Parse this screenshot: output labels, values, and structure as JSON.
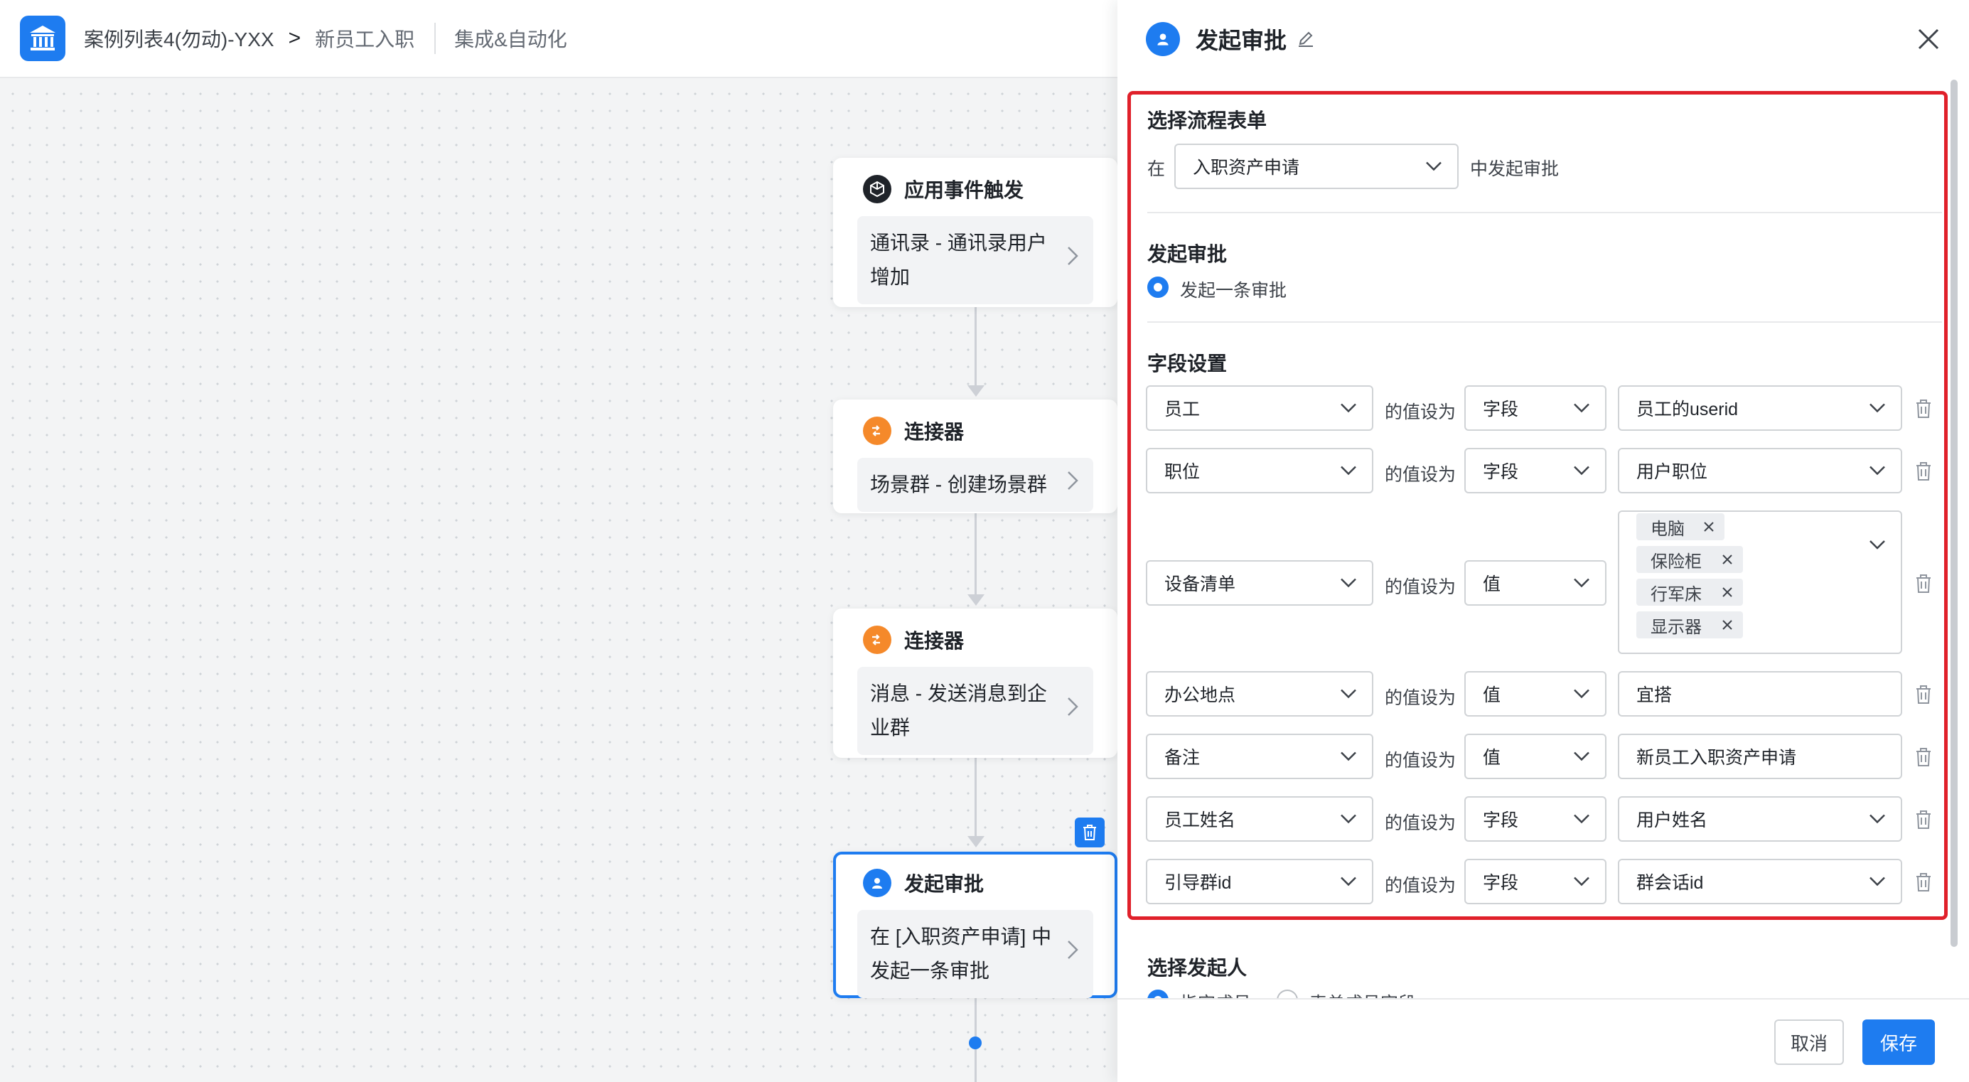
{
  "breadcrumb": {
    "app_name": "案例列表4(勿动)-YXX",
    "separator": ">",
    "page": "新员工入职",
    "section": "集成&自动化"
  },
  "flow": {
    "nodes": [
      {
        "title": "应用事件触发",
        "body": "通讯录 - 通讯录用户增加",
        "icon": "cube-icon",
        "icon_color": "#1f2329"
      },
      {
        "title": "连接器",
        "body": "场景群 - 创建场景群",
        "icon": "connector-icon",
        "icon_color": "#f5892a"
      },
      {
        "title": "连接器",
        "body": "消息 - 发送消息到企业群",
        "icon": "connector-icon",
        "icon_color": "#f5892a"
      },
      {
        "title": "发起审批",
        "body": "在 [入职资产申请] 中发起一条审批",
        "icon": "user-icon",
        "icon_color": "#1e7cf0"
      }
    ]
  },
  "drawer": {
    "title": "发起审批",
    "section_form": {
      "title": "选择流程表单",
      "prefix": "在",
      "form_value": "入职资产申请",
      "suffix": "中发起审批"
    },
    "section_approve": {
      "title": "发起审批",
      "option": "发起一条审批"
    },
    "section_fields": {
      "title": "字段设置",
      "connector": "的值设为",
      "rows": [
        {
          "field": "员工",
          "mode": "字段",
          "value": "员工的userid"
        },
        {
          "field": "职位",
          "mode": "字段",
          "value": "用户职位"
        },
        {
          "field": "设备清单",
          "mode": "值",
          "tags": [
            "电脑",
            "保险柜",
            "行军床",
            "显示器"
          ]
        },
        {
          "field": "办公地点",
          "mode": "值",
          "value": "宜搭"
        },
        {
          "field": "备注",
          "mode": "值",
          "value": "新员工入职资产申请"
        },
        {
          "field": "员工姓名",
          "mode": "字段",
          "value": "用户姓名"
        },
        {
          "field": "引导群id",
          "mode": "字段",
          "value": "群会话id"
        }
      ]
    },
    "section_initiator": {
      "title": "选择发起人",
      "option_a": "指定成员",
      "option_b": "表单成员字段"
    },
    "buttons": {
      "cancel": "取消",
      "save": "保存"
    }
  },
  "colors": {
    "accent": "#1e7cf0",
    "highlight_frame": "#e0202a",
    "connector": "#f5892a"
  }
}
